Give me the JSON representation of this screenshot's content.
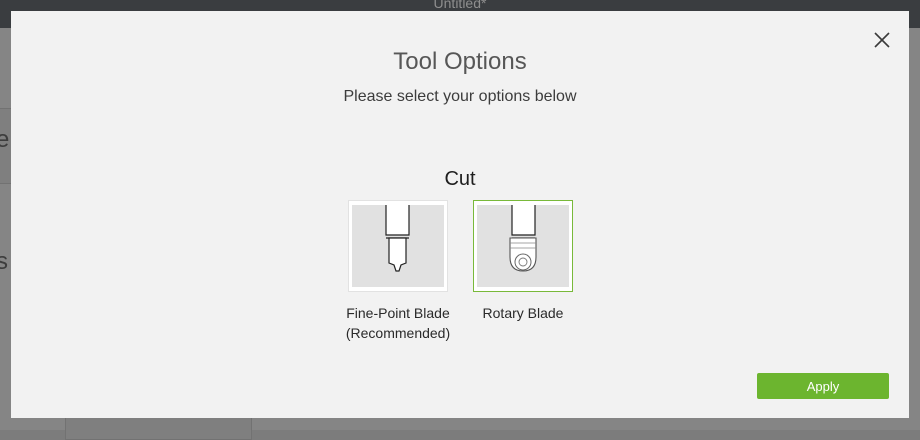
{
  "app": {
    "title": "Untitled*"
  },
  "modal": {
    "title": "Tool Options",
    "subtitle": "Please select your options below",
    "section_heading": "Cut",
    "options": [
      {
        "label_line1": "Fine-Point Blade",
        "label_line2": "(Recommended)",
        "selected": false,
        "icon": "fine-point-blade-icon"
      },
      {
        "label_line1": "Rotary Blade",
        "selected": true,
        "icon": "rotary-blade-icon"
      }
    ],
    "apply_label": "Apply",
    "close_icon": "close-icon"
  },
  "colors": {
    "accent_green": "#6cb52f",
    "selected_border": "#79b93a",
    "modal_bg": "#f2f2f2",
    "overlay": "#7c7c7c"
  }
}
